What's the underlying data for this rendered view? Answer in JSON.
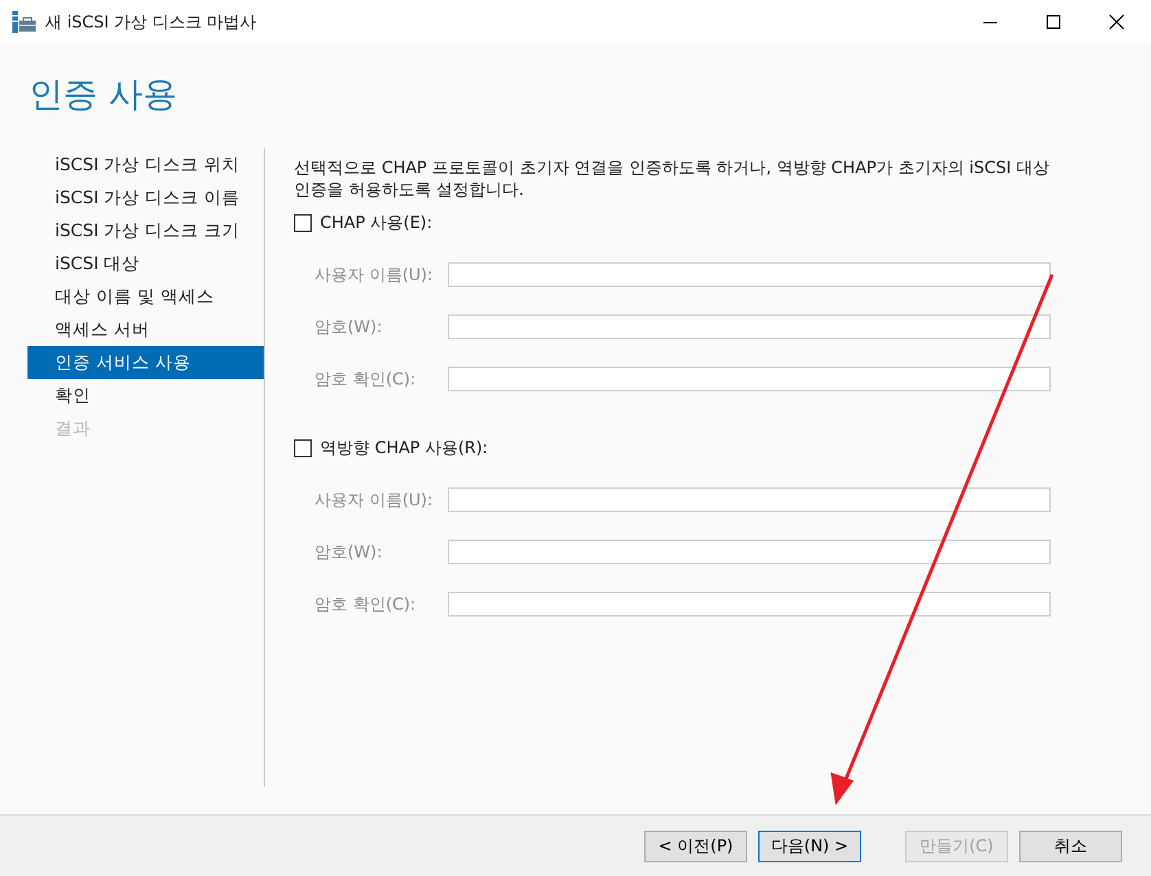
{
  "window": {
    "title": "새 iSCSI 가상 디스크 마법사"
  },
  "page_title": "인증 사용",
  "nav": [
    {
      "label": "iSCSI 가상 디스크 위치",
      "selected": false,
      "disabled": false
    },
    {
      "label": "iSCSI 가상 디스크 이름",
      "selected": false,
      "disabled": false
    },
    {
      "label": "iSCSI 가상 디스크 크기",
      "selected": false,
      "disabled": false
    },
    {
      "label": "iSCSI 대상",
      "selected": false,
      "disabled": false
    },
    {
      "label": "대상 이름 및 액세스",
      "selected": false,
      "disabled": false
    },
    {
      "label": "액세스 서버",
      "selected": false,
      "disabled": false
    },
    {
      "label": "인증 서비스 사용",
      "selected": true,
      "disabled": false
    },
    {
      "label": "확인",
      "selected": false,
      "disabled": false
    },
    {
      "label": "결과",
      "selected": false,
      "disabled": true
    }
  ],
  "description": "선택적으로 CHAP 프로토콜이 초기자 연결을 인증하도록 하거나, 역방향 CHAP가 초기자의 iSCSI 대상 인증을 허용하도록 설정합니다.",
  "sections": [
    {
      "label": "CHAP 사용(E):",
      "checked": false,
      "fields": [
        {
          "label": "사용자 이름(U):",
          "disabled": true
        },
        {
          "label": "암호(W):",
          "disabled": true
        },
        {
          "label": "암호 확인(C):",
          "disabled": true
        }
      ]
    },
    {
      "label": "역방향 CHAP 사용(R):",
      "checked": false,
      "fields": [
        {
          "label": "사용자 이름(U):",
          "disabled": true
        },
        {
          "label": "암호(W):",
          "disabled": true
        },
        {
          "label": "암호 확인(C):",
          "disabled": true
        }
      ]
    }
  ],
  "buttons": [
    {
      "label": "< 이전(P)",
      "kind": "normal",
      "disabled": false
    },
    {
      "label": "다음(N) >",
      "kind": "default",
      "disabled": false
    },
    {
      "label": "만들기(C)",
      "kind": "normal",
      "disabled": true
    },
    {
      "label": "취소",
      "kind": "normal",
      "disabled": false
    }
  ]
}
